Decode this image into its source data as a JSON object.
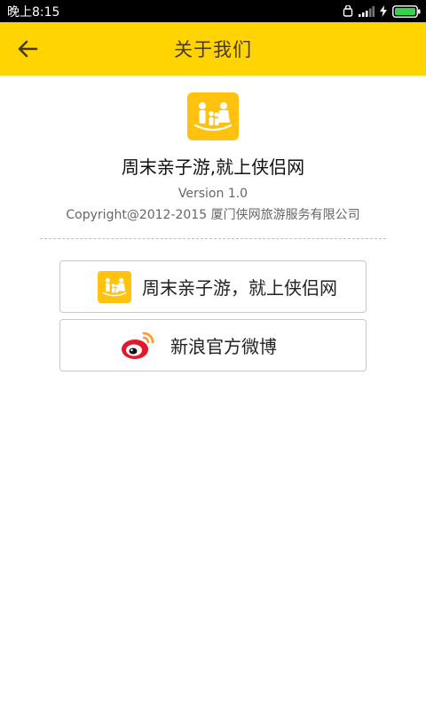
{
  "status_bar": {
    "time": "晚上8:15"
  },
  "header": {
    "title": "关于我们"
  },
  "about": {
    "slogan": "周末亲子游,就上侠侣网",
    "version": "Version 1.0",
    "copyright": "Copyright@2012-2015 厦门侠网旅游服务有限公司"
  },
  "links": {
    "site_label": "周末亲子游，就上侠侣网",
    "weibo_label": "新浪官方微博"
  },
  "colors": {
    "accent": "#ffd400",
    "logo": "#ffc20e",
    "weibo_red": "#e6162d",
    "weibo_orange": "#ff9933"
  },
  "icons": {
    "back": "arrow-left-icon",
    "logo": "family-logo-icon",
    "weibo": "weibo-icon"
  }
}
